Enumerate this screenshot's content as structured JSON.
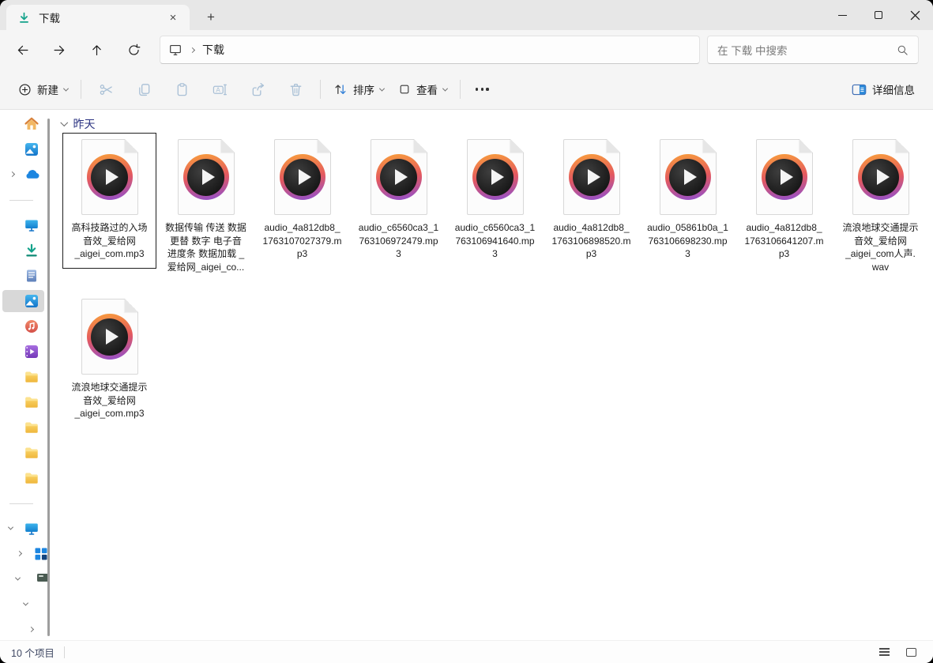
{
  "tab_bar": {
    "active_tab": {
      "title": "下载",
      "icon": "download-icon",
      "close_glyph": "×"
    },
    "new_tab_glyph": "+"
  },
  "nav_row": {
    "breadcrumb": {
      "root_icon": "this-pc-icon",
      "current": "下载"
    },
    "search": {
      "placeholder": "在 下载 中搜索",
      "icon": "search-icon"
    }
  },
  "toolbar": {
    "new_label": "新建",
    "sort_label": "排序",
    "view_label": "查看",
    "details_label": "详细信息",
    "disabled_icons": [
      "cut-icon",
      "copy-icon",
      "paste-icon",
      "rename-icon",
      "share-icon",
      "delete-icon"
    ]
  },
  "sidebar": {
    "items": [
      {
        "name": "home"
      },
      {
        "name": "gallery"
      },
      {
        "name": "onedrive",
        "expander": "collapsed"
      },
      {
        "name": "desktop"
      },
      {
        "name": "downloads"
      },
      {
        "name": "documents"
      },
      {
        "name": "pictures",
        "selected": true
      },
      {
        "name": "music"
      },
      {
        "name": "videos"
      },
      {
        "name": "folder-1"
      },
      {
        "name": "folder-2"
      },
      {
        "name": "folder-3"
      },
      {
        "name": "folder-4"
      },
      {
        "name": "folder-5"
      },
      {
        "name": "this-pc",
        "expander": "expanded"
      },
      {
        "name": "network",
        "expander": "collapsed"
      },
      {
        "name": "tree-item-1",
        "expander": "expanded"
      },
      {
        "name": "tree-item-2",
        "expander": "expanded"
      },
      {
        "name": "tree-item-3",
        "expander": "collapsed"
      }
    ]
  },
  "content": {
    "group": {
      "label": "昨天",
      "expanded": true
    },
    "files": [
      {
        "label": "高科技路过的入场\n音效_爱给网\n_aigei_com.mp3",
        "selected": true
      },
      {
        "label": "数据传输 传送 数据\n更替 数字 电子音\n进度条 数据加载 _\n爱给网_aigei_co..."
      },
      {
        "label": "audio_4a812db8_\n1763107027379.m\np3"
      },
      {
        "label": "audio_c6560ca3_1\n763106972479.mp\n3"
      },
      {
        "label": "audio_c6560ca3_1\n763106941640.mp\n3"
      },
      {
        "label": "audio_4a812db8_\n1763106898520.m\np3"
      },
      {
        "label": "audio_05861b0a_1\n763106698230.mp\n3"
      },
      {
        "label": "audio_4a812db8_\n1763106641207.m\np3"
      },
      {
        "label": "流浪地球交通提示\n音效_爱给网\n_aigei_com人声.\nwav"
      },
      {
        "label": "流浪地球交通提示\n音效_爱给网\n_aigei_com.mp3"
      }
    ]
  },
  "status_bar": {
    "items_count": "10 个项目"
  }
}
